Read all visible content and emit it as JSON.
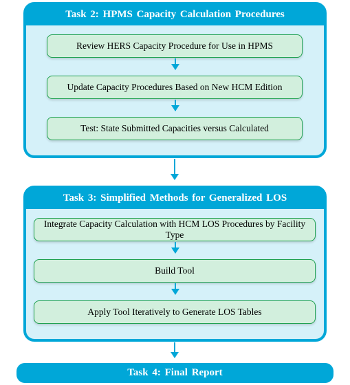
{
  "task2": {
    "title": "Task 2:  HPMS  Capacity  Calculation  Procedures",
    "steps": [
      "Review HERS Capacity Procedure for Use in HPMS",
      "Update Capacity Procedures Based on New HCM Edition",
      "Test:  State Submitted Capacities versus Calculated"
    ]
  },
  "task3": {
    "title": "Task 3:  Simplified  Methods  for Generalized  LOS",
    "steps": [
      "Integrate Capacity Calculation with HCM LOS Procedures by Facility Type",
      "Build Tool",
      "Apply Tool Iteratively to Generate LOS Tables"
    ]
  },
  "task4": {
    "title": "Task 4:  Final Report"
  }
}
